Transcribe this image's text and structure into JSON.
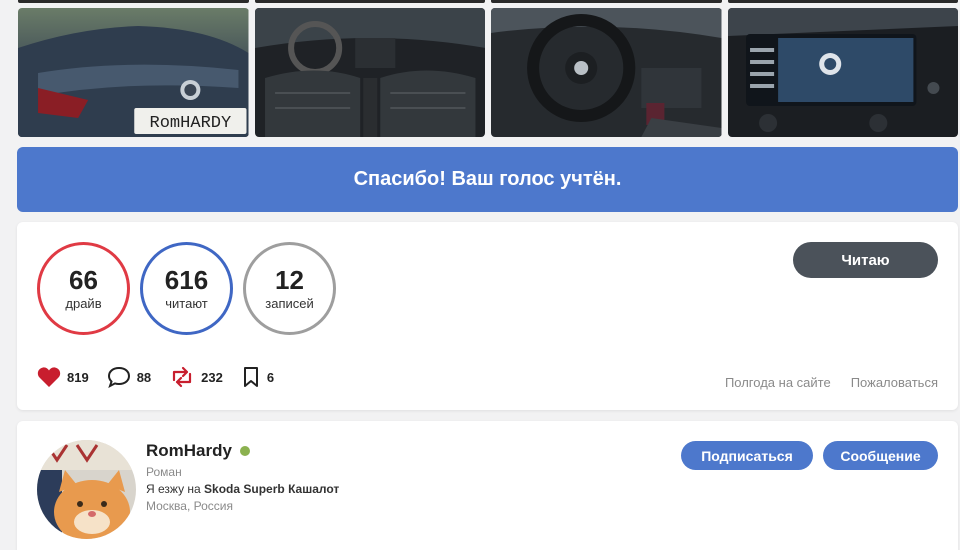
{
  "gallery": {
    "photos": [
      {
        "icon": "car-rear-photo",
        "plate": "RomHARDY"
      },
      {
        "icon": "car-interior-rear-photo"
      },
      {
        "icon": "steering-wheel-photo"
      },
      {
        "icon": "infotainment-screen-photo"
      }
    ]
  },
  "banner": {
    "text": "Спасибо! Ваш голос учтён."
  },
  "stats": {
    "drive": {
      "value": "66",
      "label": "драйв",
      "color": "#e03a44"
    },
    "followers": {
      "value": "616",
      "label": "читают",
      "color": "#3f67c4"
    },
    "posts": {
      "value": "12",
      "label": "записей",
      "color": "#9e9e9e"
    }
  },
  "read_button": {
    "label": "Читаю"
  },
  "actions": {
    "likes": {
      "icon": "heart-icon",
      "count": "819"
    },
    "comments": {
      "icon": "comment-icon",
      "count": "88"
    },
    "reposts": {
      "icon": "repost-icon",
      "count": "232"
    },
    "bookmarks": {
      "icon": "bookmark-icon",
      "count": "6"
    }
  },
  "links": {
    "online": "Полгода на сайте",
    "report": "Пожаловаться"
  },
  "profile": {
    "username": "RomHardy",
    "real_name": "Роман",
    "drives_prefix": "Я езжу на ",
    "car": "Skoda Superb Кашалот",
    "city": "Москва, Россия",
    "subscribe_label": "Подписаться",
    "message_label": "Сообщение",
    "online_color": "#8bb14f"
  }
}
